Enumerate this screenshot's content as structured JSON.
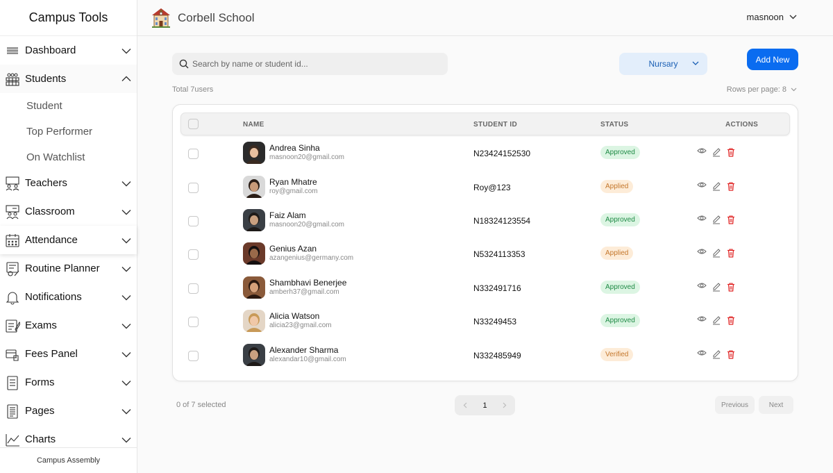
{
  "sidebar": {
    "title": "Campus Tools",
    "items": [
      {
        "label": "Dashboard",
        "icon": "list-lines-icon"
      },
      {
        "label": "Students",
        "icon": "students-icon",
        "expanded": true
      },
      {
        "label": "Teachers",
        "icon": "teachers-icon"
      },
      {
        "label": "Classroom",
        "icon": "classroom-icon"
      },
      {
        "label": "Attendance",
        "icon": "calendar-icon"
      },
      {
        "label": "Routine Planner",
        "icon": "routine-icon"
      },
      {
        "label": "Notifications",
        "icon": "bell-icon"
      },
      {
        "label": "Exams",
        "icon": "exam-icon"
      },
      {
        "label": "Fees Panel",
        "icon": "fees-icon"
      },
      {
        "label": "Forms",
        "icon": "form-icon"
      },
      {
        "label": "Pages",
        "icon": "pages-icon"
      },
      {
        "label": "Charts",
        "icon": "chart-icon"
      }
    ],
    "sub_items": [
      "Student",
      "Top Performer",
      "On Watchlist"
    ],
    "footer": "Campus Assembly"
  },
  "header": {
    "school_name": "Corbell School",
    "user": "masnoon"
  },
  "toolbar": {
    "search_placeholder": "Search by name or student id...",
    "class_select": "Nursary",
    "add_button": "Add New",
    "total": "Total 7users",
    "rows_per_page": "Rows per page: 8"
  },
  "table": {
    "columns": [
      "NAME",
      "STUDENT ID",
      "STATUS",
      "ACTIONS"
    ],
    "rows": [
      {
        "name": "Andrea Sinha",
        "email": "masnoon20@gmail.com",
        "student_id": "N23424152530",
        "status": "Approved"
      },
      {
        "name": "Ryan Mhatre",
        "email": "roy@gmail.com",
        "student_id": "Roy@123",
        "status": "Applied"
      },
      {
        "name": "Faiz Alam",
        "email": "masnoon20@gmail.com",
        "student_id": "N18324123554",
        "status": "Approved"
      },
      {
        "name": "Genius Azan",
        "email": "azangenius@germany.com",
        "student_id": "N5324113353",
        "status": "Applied"
      },
      {
        "name": "Shambhavi Benerjee",
        "email": "amberh37@gmail.com",
        "student_id": "N332491716",
        "status": "Approved"
      },
      {
        "name": "Alicia Watson",
        "email": "alicia23@gmail.com",
        "student_id": "N33249453",
        "status": "Approved"
      },
      {
        "name": "Alexander Sharma",
        "email": "alexandar10@gmail.com",
        "student_id": "N332485949",
        "status": "Verified"
      }
    ]
  },
  "footer": {
    "selected": "0 of 7 selected",
    "page": "1",
    "previous": "Previous",
    "next": "Next"
  },
  "colors": {
    "accent": "#0a6cf0",
    "approved": "#1e8a45",
    "applied": "#c4772c",
    "delete": "#e02424"
  }
}
